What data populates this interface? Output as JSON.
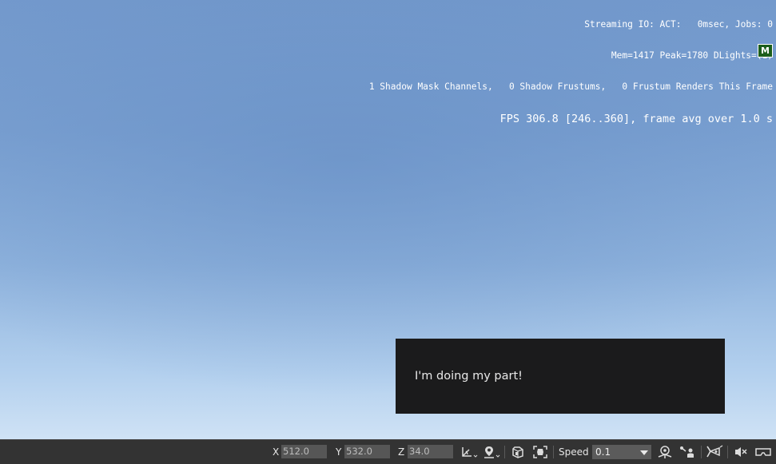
{
  "debug_overlay": {
    "line1": "Streaming IO: ACT:   0msec, Jobs: 0",
    "line2": "Mem=1417 Peak=1780 DLights=(1)",
    "line3": "1 Shadow Mask Channels,   0 Shadow Frustums,   0 Frustum Renders This Frame",
    "fps": "FPS 306.8 [246..360], frame avg over 1.0 s",
    "badge": "M"
  },
  "toast": {
    "message": "I'm doing my part!"
  },
  "toolbar": {
    "x_label": "X",
    "x_value": "512.0",
    "y_label": "Y",
    "y_value": "532.0",
    "z_label": "Z",
    "z_value": "34.0",
    "speed_label": "Speed",
    "speed_value": "0.1",
    "icons": [
      "axis-constraint-icon",
      "snap-to-terrain-icon",
      "object-snap-icon",
      "frame-selection-icon",
      "terrain-follow-icon",
      "camera-object-icon",
      "vr-preview-icon",
      "mute-icon",
      "vr-headset-icon"
    ]
  },
  "colors": {
    "sky_top": "#7399cc",
    "sky_bottom": "#cfe2f5",
    "toolbar_bg": "#333333",
    "toast_bg": "#1b1b1c",
    "badge_bg": "#1c5e1c"
  }
}
